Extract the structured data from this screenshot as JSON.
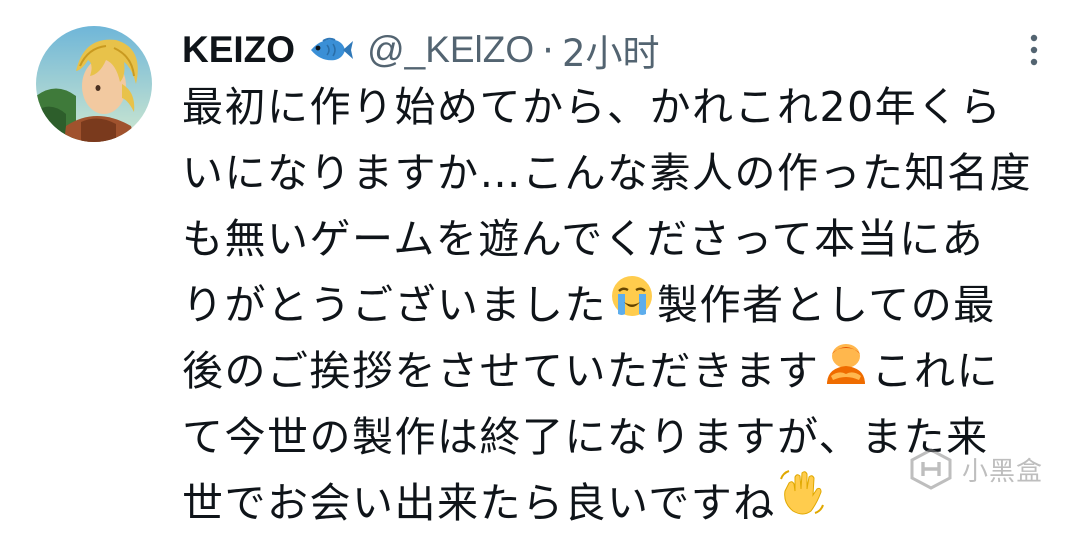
{
  "tweet": {
    "author": {
      "display_name": "KEIZO",
      "badge_icon": "fish-emoji",
      "handle": "@_KElZO"
    },
    "separator": "·",
    "timestamp": "2小时",
    "more_icon": "vertical-ellipsis-icon",
    "text_lines": [
      "最初に作り始めてから、かれこれ20年くら",
      "いになりますか…こんな素人の作った知名度",
      "も無いゲームを遊んでくださって本当にあ",
      "りがとうございました",
      "製作者としての最",
      "後のご挨拶をさせていただきます",
      "これに",
      "て今世の製作は終了になりますが、また来",
      "世でお会い出来たら良いですね"
    ],
    "emojis": [
      "loudly-crying-face",
      "person-bowing",
      "waving-hand"
    ]
  },
  "watermark": {
    "text": "小黑盒",
    "logo_icon": "heybox-logo-icon"
  }
}
